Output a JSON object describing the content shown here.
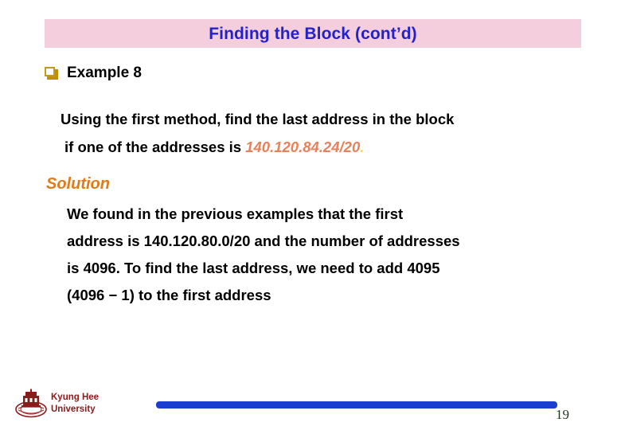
{
  "slide": {
    "title": "Finding the Block (cont’d)",
    "title_bg_color": "#f5cede",
    "title_text_color": "#2222cc",
    "page_number": "19"
  },
  "bullet": {
    "icon": "hollow-square-bullet",
    "icon_color": "#bf9000",
    "label": "Example 8"
  },
  "question": {
    "line1": "Using the first method, find the last address in the block",
    "line2_prefix": "if one of the addresses is ",
    "line2_ip": "140.120.84.24/20",
    "line2_suffix": ".",
    "ip_color": "#e8805a"
  },
  "solution": {
    "heading": "Solution",
    "heading_color": "#e07b18",
    "lines": [
      "We found in the previous examples that the first",
      "address is 140.120.80.0/20 and the number of addresses",
      "is 4096. To find the last address, we need to add 4095",
      "(4096 − 1) to the first address"
    ]
  },
  "footer": {
    "logo_icon": "kyung-hee-university-emblem",
    "university_line1": "Kyung Hee",
    "university_line2": "University",
    "university_color": "#8b1a1a",
    "bar_color": "#1a3fd0"
  }
}
